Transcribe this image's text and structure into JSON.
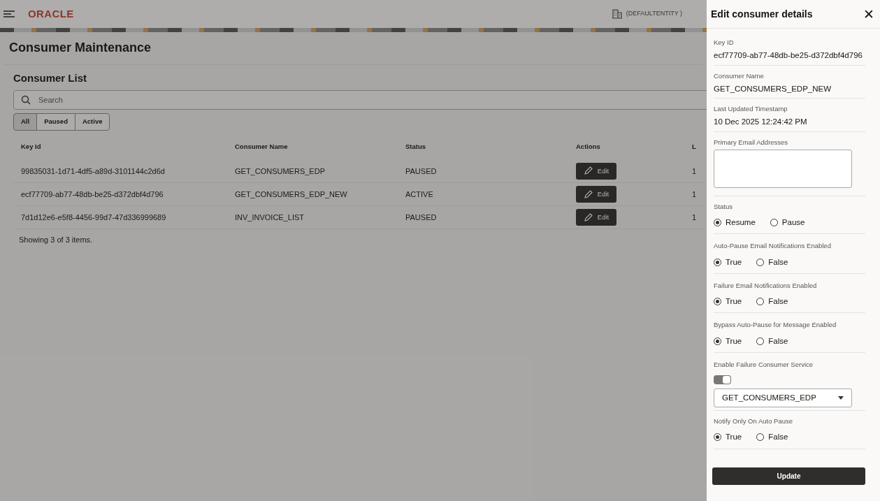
{
  "header": {
    "brand": "ORACLE",
    "entity": "(DEFAULTENTITY )"
  },
  "page_title": "Consumer Maintenance",
  "list": {
    "title": "Consumer List",
    "search": {
      "placeholder": "Search"
    },
    "filters": [
      {
        "label": "All",
        "selected": true
      },
      {
        "label": "Paused",
        "selected": false
      },
      {
        "label": "Active",
        "selected": false
      }
    ],
    "columns": [
      "Key Id",
      "Consumer Name",
      "Status",
      "Actions",
      "L"
    ],
    "rows": [
      {
        "key_id": "99835031-1d71-4df5-a89d-3101144c2d6d",
        "name": "GET_CONSUMERS_EDP",
        "status": "PAUSED",
        "action": "Edit",
        "column_5": "1"
      },
      {
        "key_id": "ecf77709-ab77-48db-be25-d372dbf4d796",
        "name": "GET_CONSUMERS_EDP_NEW",
        "status": "ACTIVE",
        "action": "Edit",
        "column_5": "1"
      },
      {
        "key_id": "7d1d12e6-e5f8-4456-99d7-47d336999689",
        "name": "INV_INVOICE_LIST",
        "status": "PAUSED",
        "action": "Edit",
        "column_5": "1"
      }
    ],
    "footer": "Showing 3 of 3 items."
  },
  "panel": {
    "title": "Edit consumer details",
    "close": "✕",
    "fields": [
      {
        "kind": "readonly",
        "label": "Key ID",
        "value": "ecf77709-ab77-48db-be25-d372dbf4d796"
      },
      {
        "kind": "readonly",
        "label": "Consumer Name",
        "value": "GET_CONSUMERS_EDP_NEW"
      },
      {
        "kind": "readonly",
        "label": "Last Updated Timestamp",
        "value": "10 Dec 2025 12:24:42 PM"
      },
      {
        "kind": "textarea",
        "label": "Primary Email Addresses"
      },
      {
        "kind": "radio",
        "label": "Status",
        "options": [
          {
            "label": "Resume",
            "selected": true
          },
          {
            "label": "Pause",
            "selected": false
          }
        ]
      },
      {
        "kind": "radio",
        "label": "Auto-Pause Email Notifications Enabled",
        "options": [
          {
            "label": "True",
            "selected": true
          },
          {
            "label": "False",
            "selected": false
          }
        ]
      },
      {
        "kind": "radio",
        "label": "Failure Email Notifications Enabled",
        "options": [
          {
            "label": "True",
            "selected": true
          },
          {
            "label": "False",
            "selected": false
          }
        ]
      },
      {
        "kind": "radio",
        "label": "Bypass Auto-Pause for Message Enabled",
        "options": [
          {
            "label": "True",
            "selected": true
          },
          {
            "label": "False",
            "selected": false
          }
        ]
      },
      {
        "kind": "toggle_select",
        "label": "Enable Failure Consumer Service",
        "on": true,
        "value": "GET_CONSUMERS_EDP"
      },
      {
        "kind": "radio",
        "label": "Notify Only On Auto Pause",
        "options": [
          {
            "label": "True",
            "selected": true
          },
          {
            "label": "False",
            "selected": false
          }
        ]
      }
    ],
    "submit": "Update"
  }
}
